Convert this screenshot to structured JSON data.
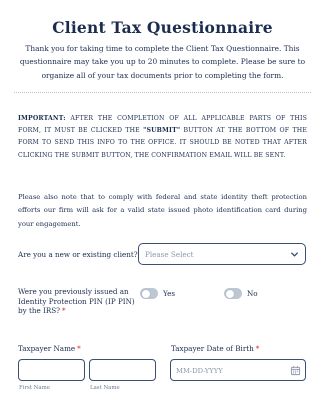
{
  "form": {
    "title": "Client Tax Questionnaire",
    "intro": "Thank you for taking time to complete the Client Tax Questionnaire. This questionnaire may take you up to 20 minutes to complete. Please be sure to organize all of your tax documents prior to completing the form.",
    "important_lead": "IMPORTANT:",
    "important_text_1": " After the completion of all applicable parts of this form, it must be clicked the ",
    "important_quoted": "\"SUBMIT\"",
    "important_text_2": " button at the bottom of the form to send this info to the office. It should be noted that after clicking the submit button, the confirmation email will be sent.",
    "note": "Please also note that to comply with federal and state identity theft protection efforts our firm will ask for a valid state issued photo identification card during your engagement."
  },
  "client_type": {
    "label": "Are you a new or existing client?",
    "required_mark": "*",
    "placeholder": "Please Select"
  },
  "ip_pin": {
    "label": "Were you previously issued an Identity Protection PIN (IP PIN) by the IRS?",
    "required_mark": "*",
    "yes_label": "Yes",
    "no_label": "No"
  },
  "taxpayer_name": {
    "label": "Taxpayer Name",
    "required_mark": "*",
    "first_sublabel": "First Name",
    "last_sublabel": "Last Name"
  },
  "taxpayer_dob": {
    "label": "Taxpayer Date of Birth",
    "required_mark": "*",
    "placeholder": "MM-DD-YYYY"
  }
}
